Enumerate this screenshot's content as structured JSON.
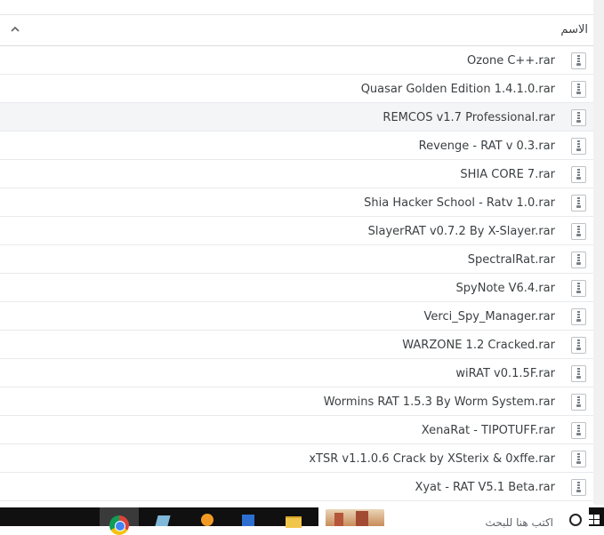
{
  "header": {
    "name_column": "الاسم"
  },
  "files": [
    {
      "name": "Ozone C++.rar",
      "icon": "archive-icon"
    },
    {
      "name": "Quasar Golden Edition 1.4.1.0.rar",
      "icon": "archive-icon"
    },
    {
      "name": "REMCOS v1.7 Professional.rar",
      "icon": "archive-icon"
    },
    {
      "name": "Revenge - RAT v 0.3.rar",
      "icon": "archive-icon"
    },
    {
      "name": "SHIA CORE 7.rar",
      "icon": "archive-icon"
    },
    {
      "name": "Shia Hacker School - Ratv 1.0.rar",
      "icon": "archive-icon"
    },
    {
      "name": "SlayerRAT v0.7.2 By X-Slayer.rar",
      "icon": "archive-icon"
    },
    {
      "name": "SpectralRat.rar",
      "icon": "archive-icon"
    },
    {
      "name": "SpyNote V6.4.rar",
      "icon": "archive-icon"
    },
    {
      "name": "Verci_Spy_Manager.rar",
      "icon": "archive-icon"
    },
    {
      "name": "WARZONE 1.2 Cracked.rar",
      "icon": "archive-icon"
    },
    {
      "name": "wiRAT v0.1.5F.rar",
      "icon": "archive-icon"
    },
    {
      "name": "Wormins RAT 1.5.3 By Worm System.rar",
      "icon": "archive-icon"
    },
    {
      "name": "XenaRat - TIPOTUFF.rar",
      "icon": "archive-icon"
    },
    {
      "name": "xTSR v1.1.0.6 Crack by XSterix & 0xffe.rar",
      "icon": "archive-icon"
    },
    {
      "name": "Xyat - RAT V5.1 Beta.rar",
      "icon": "archive-icon"
    }
  ],
  "taskbar": {
    "search_text": "اكتب هنا للبحث",
    "apps": [
      "chrome-icon",
      "app-icon",
      "app-icon",
      "app-icon",
      "folder-icon"
    ]
  },
  "colors": {
    "row_border": "#e8eaed",
    "highlight_row": "#f4f5f7",
    "taskbar": "#101010"
  }
}
